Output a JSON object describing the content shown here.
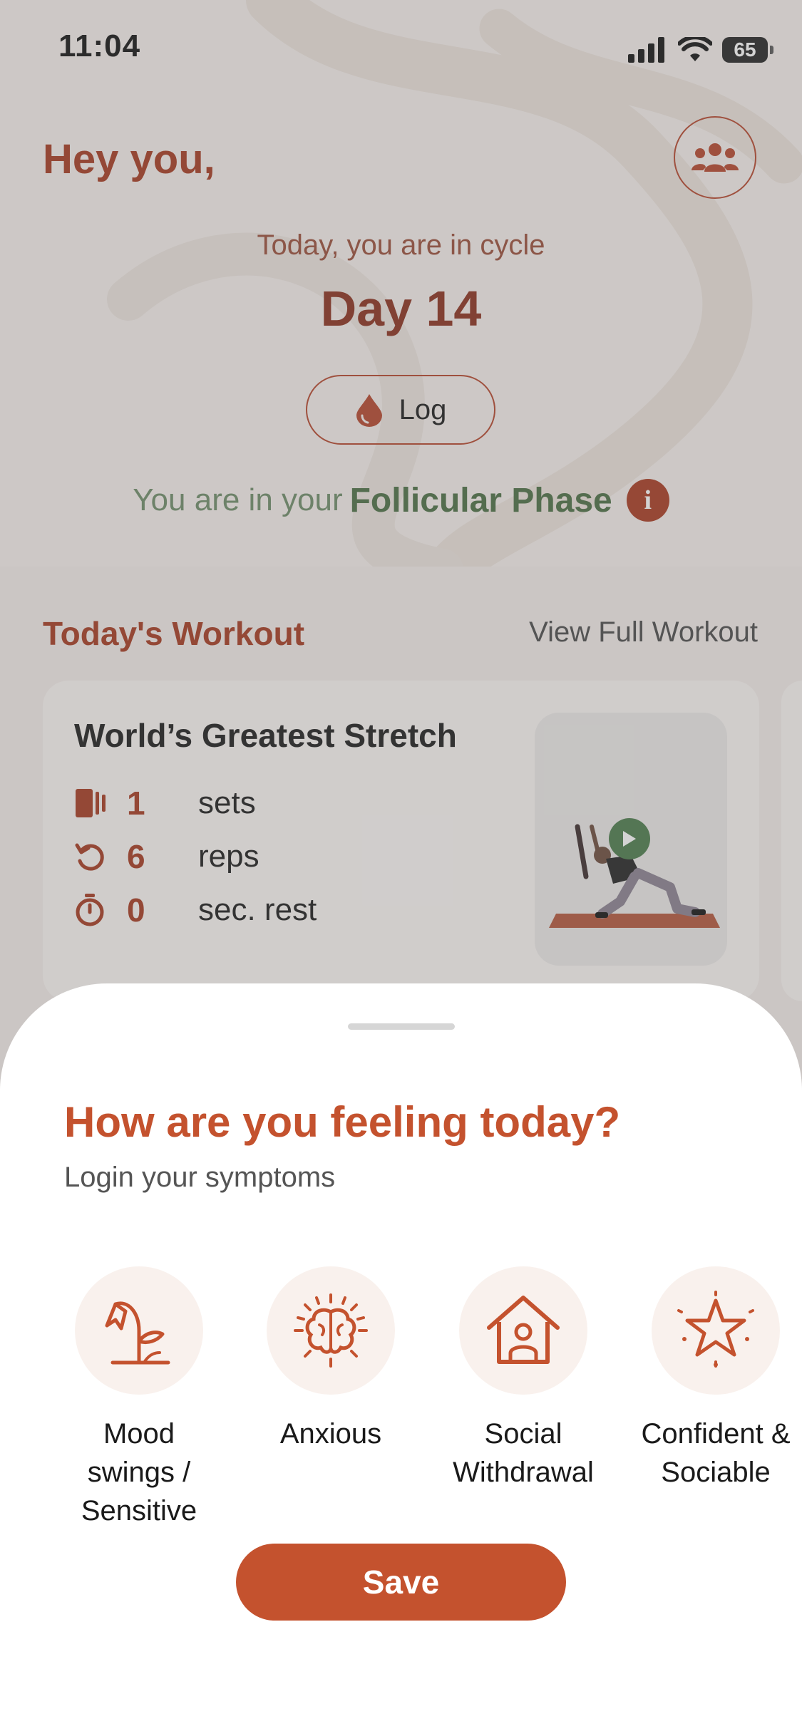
{
  "status_bar": {
    "time": "11:04",
    "battery": "65"
  },
  "header": {
    "greeting": "Hey you,"
  },
  "cycle": {
    "intro": "Today, you are in cycle",
    "day": "Day 14",
    "log_label": "Log",
    "phase_prefix": "You are in your",
    "phase_name": "Follicular Phase"
  },
  "workout": {
    "section_title": "Today's Workout",
    "view_full_label": "View Full Workout",
    "exercise": {
      "name": "World’s Greatest Stretch",
      "stats": [
        {
          "icon": "sets-icon",
          "value": "1",
          "unit": "sets"
        },
        {
          "icon": "reps-icon",
          "value": "6",
          "unit": "reps"
        },
        {
          "icon": "timer-icon",
          "value": "0",
          "unit": "sec. rest"
        }
      ]
    }
  },
  "sheet": {
    "title": "How are you feeling today?",
    "subtitle": "Login your symptoms",
    "symptoms": [
      {
        "icon": "wilted-flower-icon",
        "label_line1": "Mood swings /",
        "label_line2": "Sensitive"
      },
      {
        "icon": "brain-icon",
        "label_line1": "Anxious",
        "label_line2": ""
      },
      {
        "icon": "house-person-icon",
        "label_line1": "Social",
        "label_line2": "Withdrawal"
      },
      {
        "icon": "star-icon",
        "label_line1": "Confident &",
        "label_line2": "Sociable"
      }
    ],
    "save_label": "Save"
  },
  "colors": {
    "brand": "#c4522e",
    "brand_dark": "#a5391f",
    "phase_green": "#4a6d43",
    "symptom_bg": "#f9f1ed"
  }
}
